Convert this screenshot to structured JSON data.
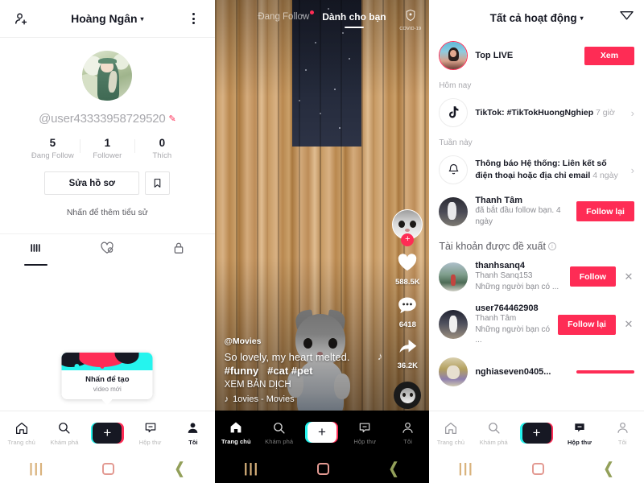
{
  "accent": "#fe2c55",
  "cyan": "#25f4ee",
  "profile": {
    "header_title": "Hoàng Ngân",
    "caret": "▾",
    "add_friend_icon": "add-person-icon",
    "more_icon": "more-options-icon",
    "username": "@user43333958729520",
    "edit_pencil": "✎",
    "stats": [
      {
        "num": "5",
        "cap": "Đang Follow"
      },
      {
        "num": "1",
        "cap": "Follower"
      },
      {
        "num": "0",
        "cap": "Thích"
      }
    ],
    "edit_button": "Sửa hồ sơ",
    "bookmark_icon": "bookmark-icon",
    "bio_prompt": "Nhấn để thêm tiểu sử",
    "tabs": [
      {
        "icon": "grid-icon",
        "active": true
      },
      {
        "icon": "heart-slash-icon",
        "active": false
      },
      {
        "icon": "lock-icon",
        "active": false
      }
    ],
    "create_tip": {
      "title": "Nhấn để tạo",
      "subtitle": "video mới"
    }
  },
  "feed": {
    "tabs": [
      {
        "label": "Đang Follow",
        "active": false,
        "dot": true
      },
      {
        "label": "Dành cho bạn",
        "active": true,
        "dot": false
      }
    ],
    "covid_label": "COVID-19",
    "covid_icon": "shield-icon",
    "author": "@Movies",
    "caption_main": "So lovely, my heart melted.",
    "hashtags": [
      "#funny",
      "#cat",
      "#pet"
    ],
    "translate": "XEM BẢN DỊCH",
    "music_icon": "music-note-icon",
    "music": "1ovies - Movies",
    "actions": [
      {
        "icon": "heart-icon",
        "count": "588.5K"
      },
      {
        "icon": "comment-icon",
        "count": "6418"
      },
      {
        "icon": "share-icon",
        "count": "36.2K"
      }
    ],
    "follow_plus": "+"
  },
  "inbox": {
    "title": "Tất cả hoạt động",
    "caret": "▾",
    "filter_icon": "filter-icon",
    "live": {
      "name": "Top LIVE",
      "button": "Xem",
      "avatar": "live-avatar"
    },
    "sections": [
      {
        "label": "Hôm nay"
      },
      {
        "label": "Tuần này"
      }
    ],
    "today": [
      {
        "icon": "tiktok-logo-icon",
        "bold": "TikTok: #TikTokHuongNghiep",
        "time": "7 giờ",
        "chevron": "›"
      }
    ],
    "this_week": [
      {
        "icon": "bell-icon",
        "bold": "Thông báo Hệ thống: Liên kết số điện thoại hoặc địa chỉ email",
        "time": "4 ngày",
        "chevron": "›"
      },
      {
        "avatar": "photo-avatar-2",
        "name": "Thanh Tâm",
        "sub": "đã bắt đầu follow bạn.",
        "time": "4 ngày",
        "button": "Follow lại"
      }
    ],
    "suggested_header": "Tài khoản được đề xuất",
    "suggested_info_icon": "info-icon",
    "suggested": [
      {
        "avatar": "photo-avatar-3",
        "name": "thanhsanq4",
        "sub1": "Thanh Sanq153",
        "sub2": "Những người bạn có ...",
        "button": "Follow",
        "close": "✕"
      },
      {
        "avatar": "photo-avatar-4",
        "name": "user764462908",
        "sub1": "Thanh Tâm",
        "sub2": "Những người bạn có ...",
        "button": "Follow lại",
        "close": "✕"
      },
      {
        "avatar": "photo-avatar-5",
        "name": "nghiaseven0405...",
        "sub1": "",
        "sub2": "",
        "button": "",
        "close": ""
      }
    ]
  },
  "tabbar": {
    "items": [
      {
        "label": "Trang chủ",
        "icon": "home-icon"
      },
      {
        "label": "Khám phá",
        "icon": "search-icon"
      },
      {
        "label": "",
        "icon": "create-plus-icon"
      },
      {
        "label": "Hộp thư",
        "icon": "inbox-icon"
      },
      {
        "label": "Tôi",
        "icon": "profile-icon"
      }
    ],
    "active_profile": 4,
    "active_feed": 0,
    "active_inbox": 3
  },
  "sysnav": {
    "recent_icon": "recents-icon",
    "home_icon": "home-square-icon",
    "back_icon": "back-chevron-icon"
  }
}
